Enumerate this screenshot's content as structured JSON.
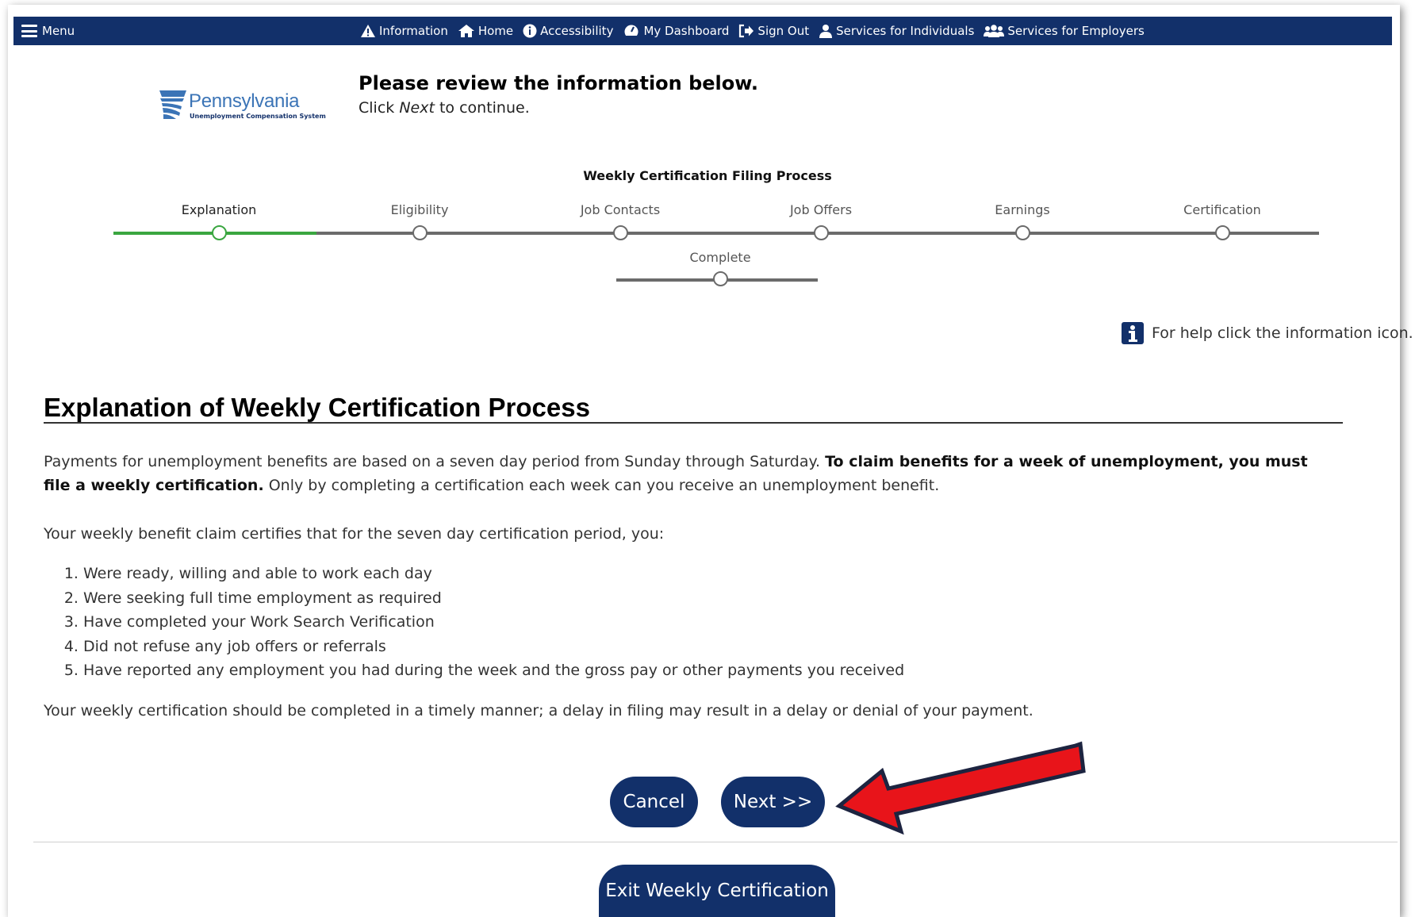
{
  "nav": {
    "menu_label": "Menu",
    "items": [
      {
        "label": "Information",
        "icon": "warning-triangle-icon"
      },
      {
        "label": "Home",
        "icon": "home-icon"
      },
      {
        "label": "Accessibility",
        "icon": "info-circle-icon"
      },
      {
        "label": "My Dashboard",
        "icon": "dashboard-gauge-icon"
      },
      {
        "label": "Sign Out",
        "icon": "sign-out-icon"
      },
      {
        "label": "Services for Individuals",
        "icon": "person-icon"
      },
      {
        "label": "Services for Employers",
        "icon": "group-icon"
      }
    ],
    "bg_color": "#12306a"
  },
  "logo": {
    "word": "Pennsylvania",
    "subtitle": "Unemployment Compensation System"
  },
  "header": {
    "title": "Please review the information below.",
    "instruction_prefix": "Click ",
    "instruction_emphasis": "Next",
    "instruction_suffix": " to continue."
  },
  "stepper": {
    "title": "Weekly Certification Filing Process",
    "steps": [
      {
        "label": "Explanation",
        "state": "active"
      },
      {
        "label": "Eligibility",
        "state": "pending"
      },
      {
        "label": "Job Contacts",
        "state": "pending"
      },
      {
        "label": "Job Offers",
        "state": "pending"
      },
      {
        "label": "Earnings",
        "state": "pending"
      },
      {
        "label": "Certification",
        "state": "pending"
      },
      {
        "label": "Complete",
        "state": "pending"
      }
    ],
    "active_color": "#3aa640"
  },
  "help": {
    "text": "For help click the information icon."
  },
  "content": {
    "title": "Explanation of Weekly Certification Process",
    "p1_start": "Payments for unemployment benefits are based on a seven day period from Sunday through Saturday. ",
    "p1_bold": "To claim benefits for a week of unemployment, you must file a weekly certification.",
    "p1_end": " Only by completing a certification each week can you receive an unemployment benefit.",
    "p2": "Your weekly benefit claim certifies that for the seven day certification period, you:",
    "list": [
      "Were ready, willing and able to work each day",
      "Were seeking full time employment as required",
      "Have completed your Work Search Verification",
      "Did not refuse any job offers or referrals",
      "Have reported any employment you had during the week and the gross pay or other payments you received"
    ],
    "p3": "Your weekly certification should be completed in a timely manner; a delay in filing may result in a delay or denial of your payment."
  },
  "buttons": {
    "cancel": "Cancel",
    "next": "Next >>",
    "exit": "Exit Weekly Certification"
  },
  "annotation": {
    "arrow_color": "#e8141a"
  }
}
